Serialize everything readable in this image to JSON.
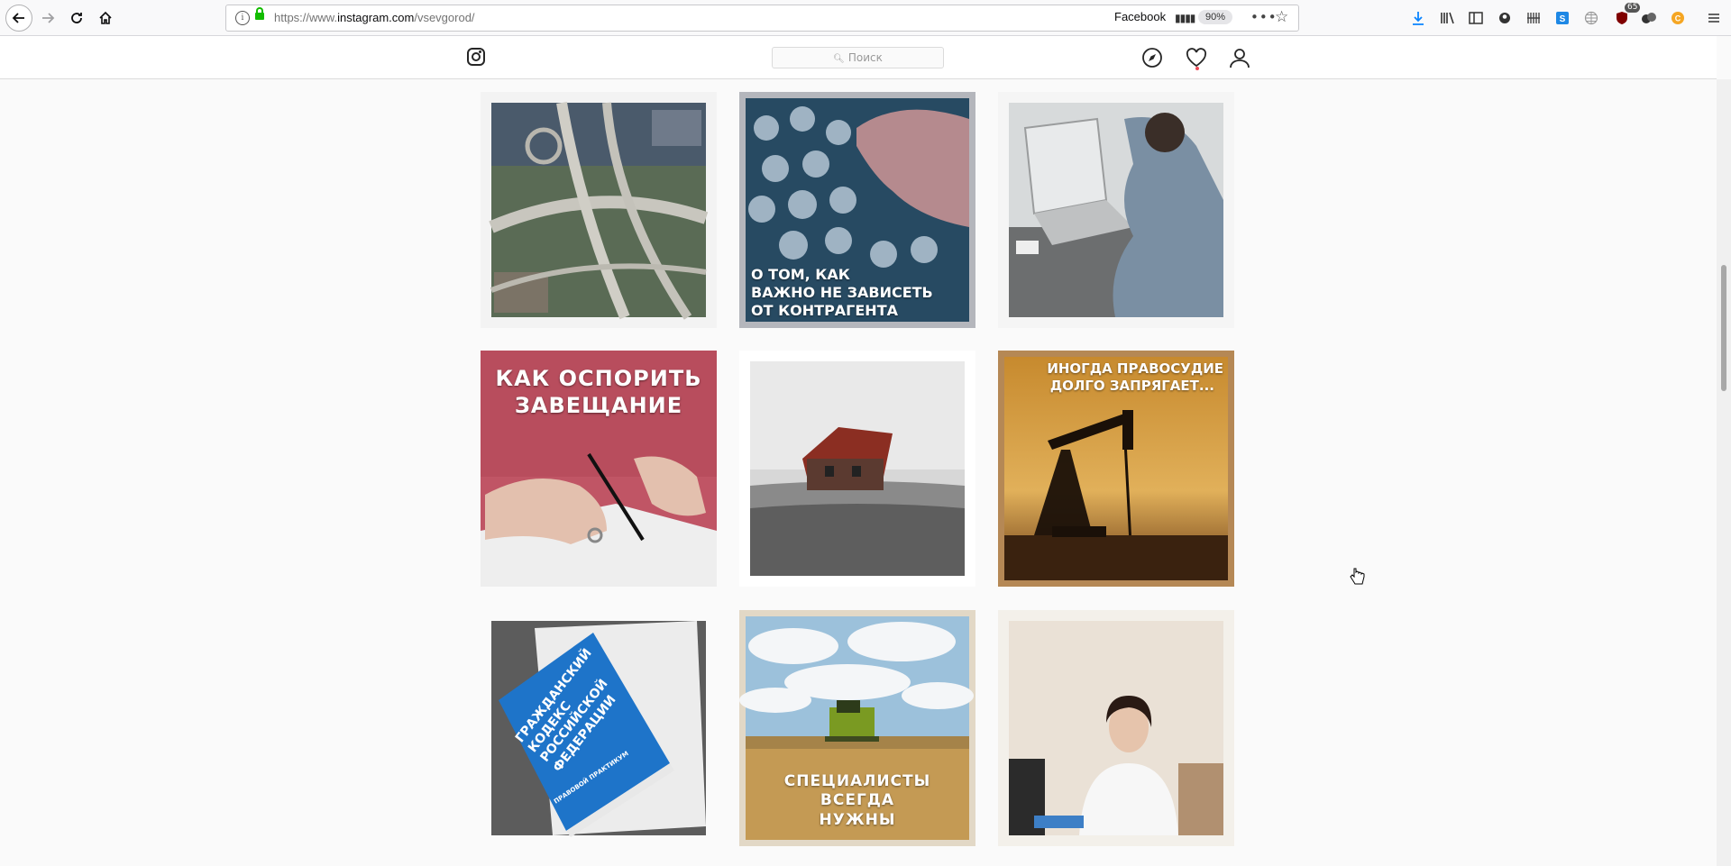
{
  "browser": {
    "url_prefix": "https://www.",
    "url_domain": "instagram.com",
    "url_path": "/vsevgorod/",
    "facebook_label": "Facebook",
    "zoom": "90%",
    "notification_badge": "65"
  },
  "instagram": {
    "search_placeholder": "Поиск"
  },
  "posts": [
    {
      "caption": "",
      "scene": "highway interchange aerial"
    },
    {
      "caption_lines": [
        "О ТОМ, КАК",
        "ВАЖНО НЕ ЗАВИСЕТЬ",
        "ОТ КОНТРАГЕНТА"
      ],
      "scene": "dumplings"
    },
    {
      "caption": "",
      "scene": "person typing on laptop"
    },
    {
      "caption_lines": [
        "КАК ОСПОРИТЬ",
        "ЗАВЕЩАНИЕ"
      ],
      "scene": "hand signing document"
    },
    {
      "caption": "",
      "scene": "old house in field"
    },
    {
      "caption_lines": [
        "ИНОГДА ПРАВОСУДИЕ",
        "ДОЛГО ЗАПРЯГАЕТ..."
      ],
      "scene": "oil pump at sunset"
    },
    {
      "book_lines": [
        "ГРАЖДАНСКИЙ",
        "КОДЕКС",
        "РОССИЙСКОЙ",
        "ФЕДЕРАЦИИ"
      ],
      "book_footer": "ПРАВОВОЙ ПРАКТИКУМ",
      "scene": "civil code book"
    },
    {
      "caption_lines": [
        "СПЕЦИАЛИСТЫ",
        "ВСЕГДА",
        "НУЖНЫ"
      ],
      "scene": "combine harvester in wheat field"
    },
    {
      "caption": "",
      "scene": "woman at office desk"
    }
  ],
  "colors": {
    "background": "#fafafa",
    "header_bg": "#ffffff",
    "notification_red": "#ed4956"
  }
}
